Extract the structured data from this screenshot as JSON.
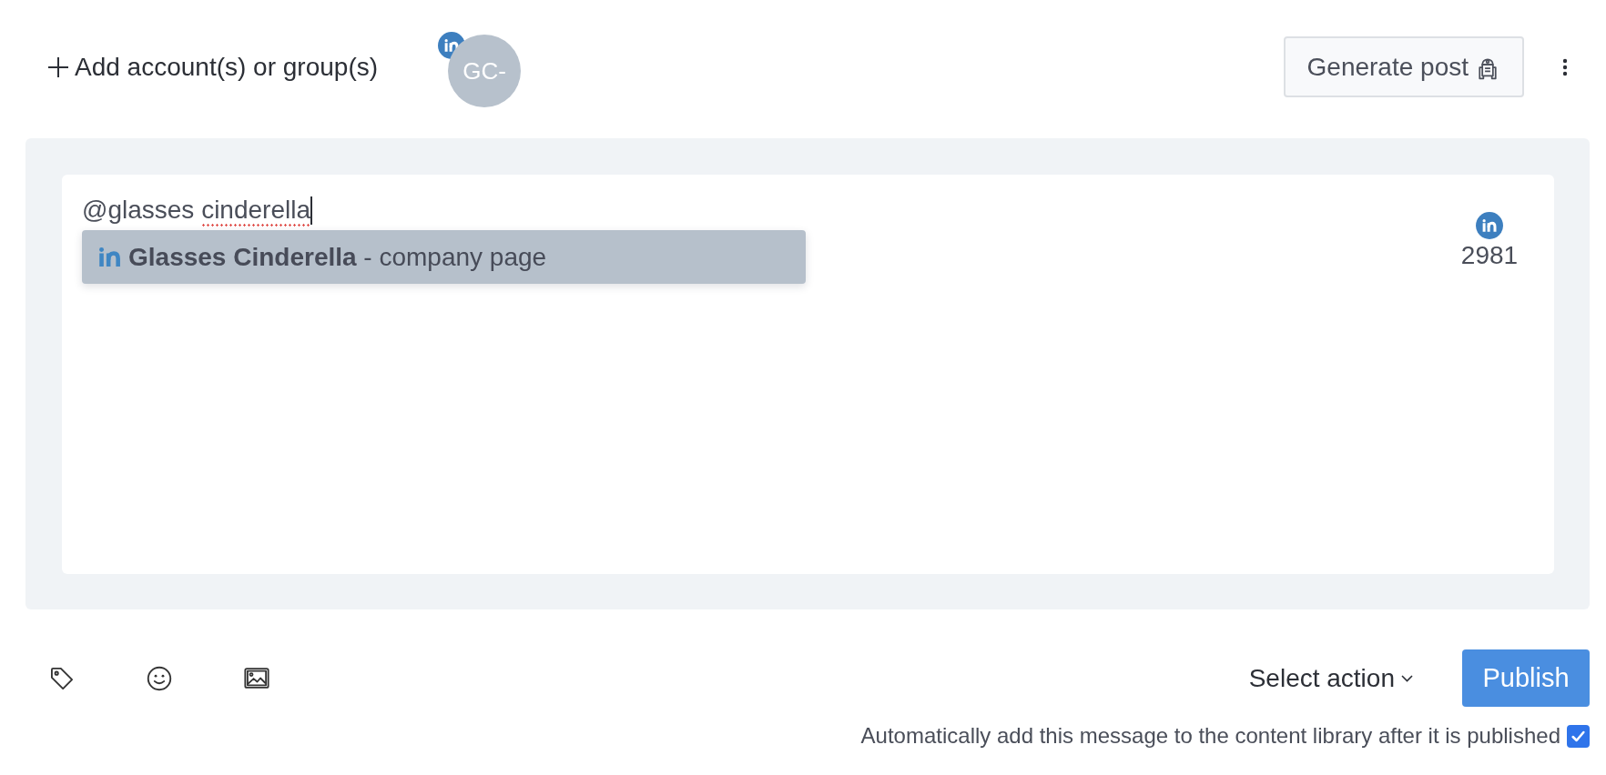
{
  "header": {
    "add_button": {
      "label": "Add account(s) or group(s)"
    },
    "accounts": [
      {
        "initials": "GC-",
        "kind": "linkedin"
      }
    ],
    "generate_button": {
      "label": "Generate post"
    }
  },
  "composer": {
    "editor": {
      "focused": true,
      "parts": [
        {
          "text": "@glasses ",
          "misspelled": false
        },
        {
          "text": "cinderella",
          "misspelled": true
        }
      ]
    },
    "suggestions": [
      {
        "kind": "linkedin",
        "label": "**Glasses Cinderella** - company page",
        "selected": true
      }
    ],
    "counters": [
      {
        "kind": "linkedin",
        "count": "2981"
      }
    ]
  },
  "footer": {
    "action_select": {
      "label": "Select action"
    },
    "publish_button": {
      "label": "Publish"
    },
    "auto_add": {
      "label": "Automatically add this message to the content library after it is published",
      "checked": true
    }
  }
}
